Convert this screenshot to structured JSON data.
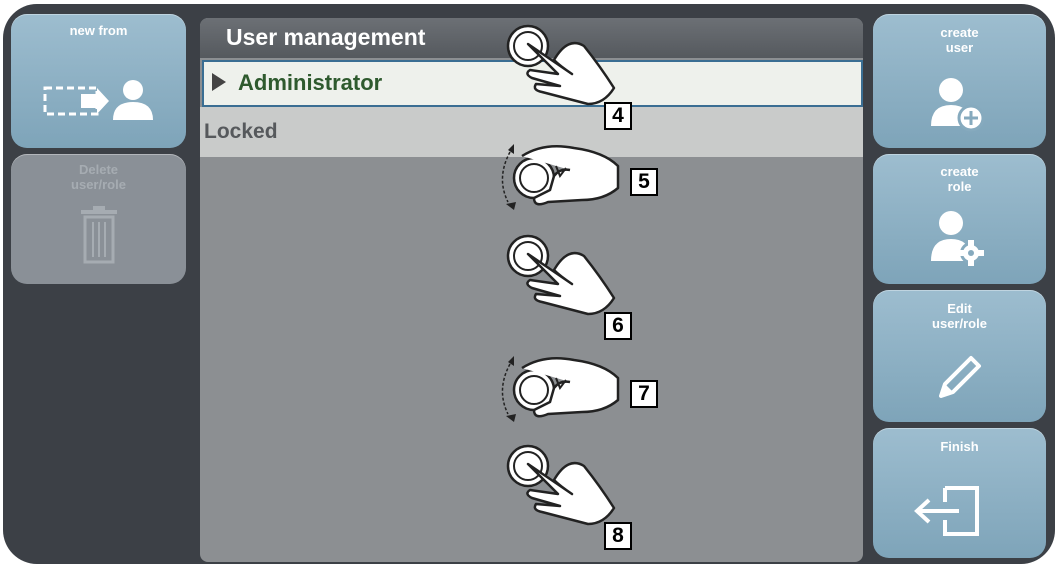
{
  "left_buttons": {
    "new_from": {
      "label": "new from",
      "icon": "copy-user-icon"
    },
    "delete": {
      "label_line1": "Delete",
      "label_line2": "user/role",
      "icon": "trash-icon",
      "state": "disabled"
    }
  },
  "panel": {
    "title": "User management",
    "rows": [
      {
        "label": "Administrator",
        "selected": true
      },
      {
        "label": "Locked",
        "selected": false
      }
    ]
  },
  "right_buttons": {
    "create_user": {
      "label_line1": "create",
      "label_line2": "user",
      "icon": "add-user-icon"
    },
    "create_role": {
      "label_line1": "create",
      "label_line2": "role",
      "icon": "user-gear-icon"
    },
    "edit": {
      "label_line1": "Edit",
      "label_line2": "user/role",
      "icon": "pencil-icon"
    },
    "finish": {
      "label": "Finish",
      "icon": "exit-icon"
    }
  },
  "steps": [
    "4",
    "5",
    "6",
    "7",
    "8"
  ],
  "colors": {
    "frame": "#3c4046",
    "button": "#8fb1c4",
    "panel": "#8c8f92",
    "selected_row": "#eef1ec",
    "selected_text": "#2e5a2e"
  }
}
